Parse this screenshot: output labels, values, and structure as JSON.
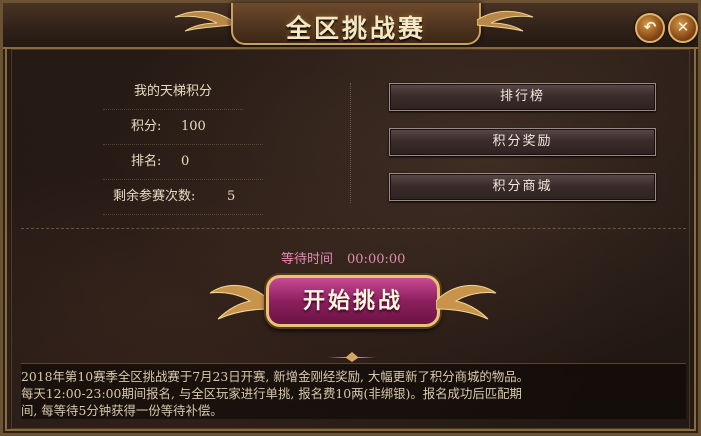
{
  "window": {
    "title": "全区挑战赛"
  },
  "ladder": {
    "heading": "我的天梯积分",
    "score_label": "积分:",
    "score_value": "100",
    "rank_label": "排名:",
    "rank_value": "0",
    "remaining_label": "剩余参赛次数:",
    "remaining_value": "5"
  },
  "menu": {
    "leaderboard": "排行榜",
    "rewards": "积分奖励",
    "shop": "积分商城"
  },
  "queue": {
    "wait_label": "等待时间",
    "wait_time": "00:00:00"
  },
  "actions": {
    "start": "开始挑战"
  },
  "notice": {
    "line1": "2018年第10赛季全区挑战赛于7月23日开赛, 新增金刚经奖励, 大幅更新了积分商城的物品。",
    "line2": "每天12:00-23:00期间报名, 与全区玩家进行单挑, 报名费10两(非绑银)。报名成功后匹配期",
    "line3": "间, 每等待5分钟获得一份等待补偿。"
  },
  "colors": {
    "accent_gold": "#c9a05a",
    "start_button": "#8d1f5e",
    "wait_text": "#e08bb3"
  },
  "icons": {
    "back": "back-arrow-icon",
    "close": "close-icon"
  }
}
